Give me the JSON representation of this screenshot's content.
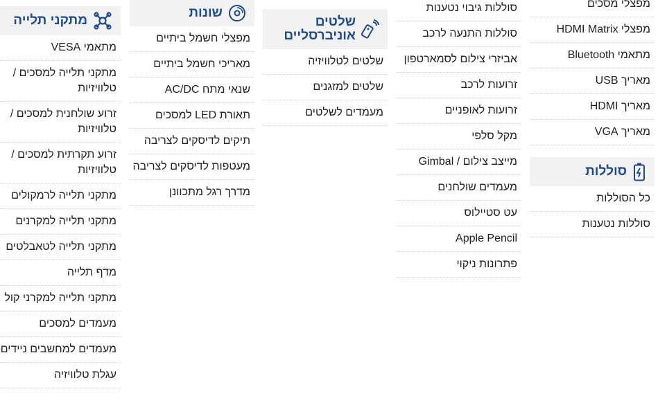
{
  "colors": {
    "heading": "#1e4b8f",
    "header_bg": "#f2f2f2",
    "divider": "#cfcfcf"
  },
  "mounts": {
    "title": "מתקני תלייה",
    "icon": "mount-cross-icon",
    "items": [
      "מתאמי VESA",
      "מתקני תלייה למסכים / טלוויזיות",
      "זרוע שולחנית למסכים / טלוויזיות",
      "זרוע תקרתית למסכים / טלוויזיות",
      "מתקני תלייה לרמקולים",
      "מתקני תלייה למקרנים",
      "מתקני תלייה לטאבלטים",
      "מדף תלייה",
      "מתקני תלייה למקרני קול",
      "מעמדים למסכים",
      "מעמדים למחשבים ניידים",
      "עגלת טלוויזיה"
    ]
  },
  "misc": {
    "title": "שונות",
    "icon": "disc-icon",
    "items": [
      "מפצלי חשמל ביתיים",
      "מאריכי חשמל ביתיים",
      "שנאי מתח AC/DC",
      "תאורת LED למסכים",
      "תיקים לדיסקים לצריבה",
      "מעטפות לדיסקים לצריבה",
      "מדרך רגל מתכוונן"
    ]
  },
  "remotes": {
    "title": "שלטים אוניברסליים",
    "icon": "remote-control-icon",
    "items": [
      "שלטים לטלוויזיה",
      "שלטים למזגנים",
      "מעמדים לשלטים"
    ]
  },
  "accessories": {
    "items": [
      "סוללות גיבוי נטענות",
      "סוללות התנעה לרכב",
      "אביזרי צילום לסמארטפון",
      "זרועות לרכב",
      "זרועות לאופניים",
      "מקל סלפי",
      "מייצב צילום / Gimbal",
      "מעמדים שולחנים",
      "עט סטיילוס",
      "Apple Pencil",
      "פתרונות ניקוי"
    ]
  },
  "cables": {
    "items": [
      "מפצלי מסכים",
      "מפצלי HDMI Matrix",
      "מתאמי Bluetooth",
      "מאריך USB",
      "מאריך HDMI",
      "מאריך VGA"
    ]
  },
  "batteries": {
    "title": "סוללות",
    "icon": "battery-icon",
    "items": [
      "כל הסוללות",
      "סוללות נטענות"
    ]
  }
}
